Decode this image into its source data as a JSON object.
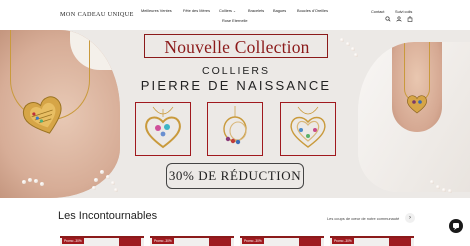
{
  "header": {
    "logo": "MON CADEAU UNIQUE",
    "nav": [
      {
        "label": "Meilleures Ventes"
      },
      {
        "label": "Fête des Mères"
      },
      {
        "label": "Colliers",
        "dropdown": true
      },
      {
        "label": "Bracelets"
      },
      {
        "label": "Bagues"
      },
      {
        "label": "Boucles d'Oreilles"
      },
      {
        "label": "Rose Eternelle"
      }
    ],
    "contact": "Contact",
    "suivi": "Suivi colis",
    "icons": [
      "search-icon",
      "account-icon",
      "cart-icon"
    ]
  },
  "banner": {
    "title": "Nouvelle Collection",
    "subtitle_1": "COLLIERS",
    "subtitle_2": "PIERRE DE NAISSANCE",
    "products": [
      "heart-stones-necklace",
      "rings-birthstone-necklace",
      "heart-family-necklace"
    ],
    "promo": "30% DE RÉDUCTION",
    "colors": {
      "title_red": "#8b1a1a",
      "frame_red": "#a0191e",
      "bg": "#ece9e6"
    }
  },
  "section": {
    "title": "Les Incontournables",
    "link": "Les coups de cœur de notre communauté",
    "arrow": "›",
    "cards": [
      {
        "badge": "Promo -30%"
      },
      {
        "badge": "Promo -30%"
      },
      {
        "badge": "Promo -30%"
      },
      {
        "badge": "Promo -30%"
      }
    ]
  }
}
